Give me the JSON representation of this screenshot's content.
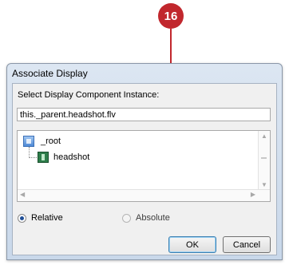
{
  "callout": {
    "number": "16",
    "color": "#c1272d"
  },
  "dialog": {
    "title": "Associate Display",
    "select_label": "Select Display Component Instance:",
    "instance_path": "this._parent.headshot.flv",
    "tree": {
      "root_label": "_root",
      "root_icon": "movie-clip-icon",
      "child_label": "headshot",
      "child_icon": "flv-playback-component-icon"
    },
    "radio_relative": {
      "label": "Relative",
      "checked": true
    },
    "radio_absolute": {
      "label": "Absolute",
      "checked": false
    },
    "ok_label": "OK",
    "cancel_label": "Cancel"
  }
}
